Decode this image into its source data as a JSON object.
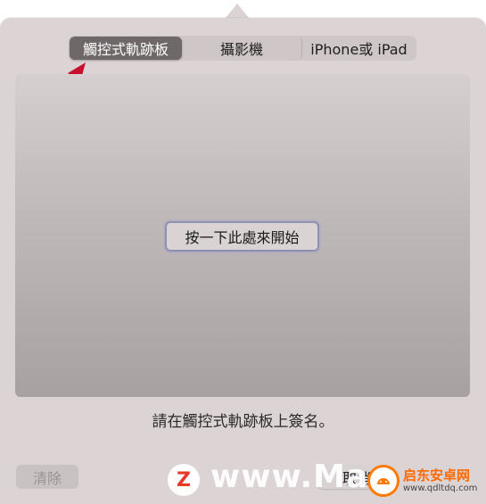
{
  "segmented_control": {
    "tabs": [
      {
        "label": "觸控式軌跡板",
        "active": true
      },
      {
        "label": "攝影機",
        "active": false
      },
      {
        "label": "iPhone或 iPad",
        "active": false
      }
    ]
  },
  "pad": {
    "start_label": "按一下此處來開始"
  },
  "instruction": "請在觸控式軌跡板上簽名。",
  "footer": {
    "clear_label": "清除",
    "cancel_label": "取消"
  },
  "watermark": {
    "logo_letter": "Z",
    "text": "www.Mac",
    "badge_name": "启东安卓网",
    "badge_url": "www.qdltdq.com"
  },
  "colors": {
    "panel": "#dcd3d4",
    "active_tab": "#6e6869",
    "annotation_arrow": "#c8102e",
    "focus_ring": "#8f8fb3"
  }
}
